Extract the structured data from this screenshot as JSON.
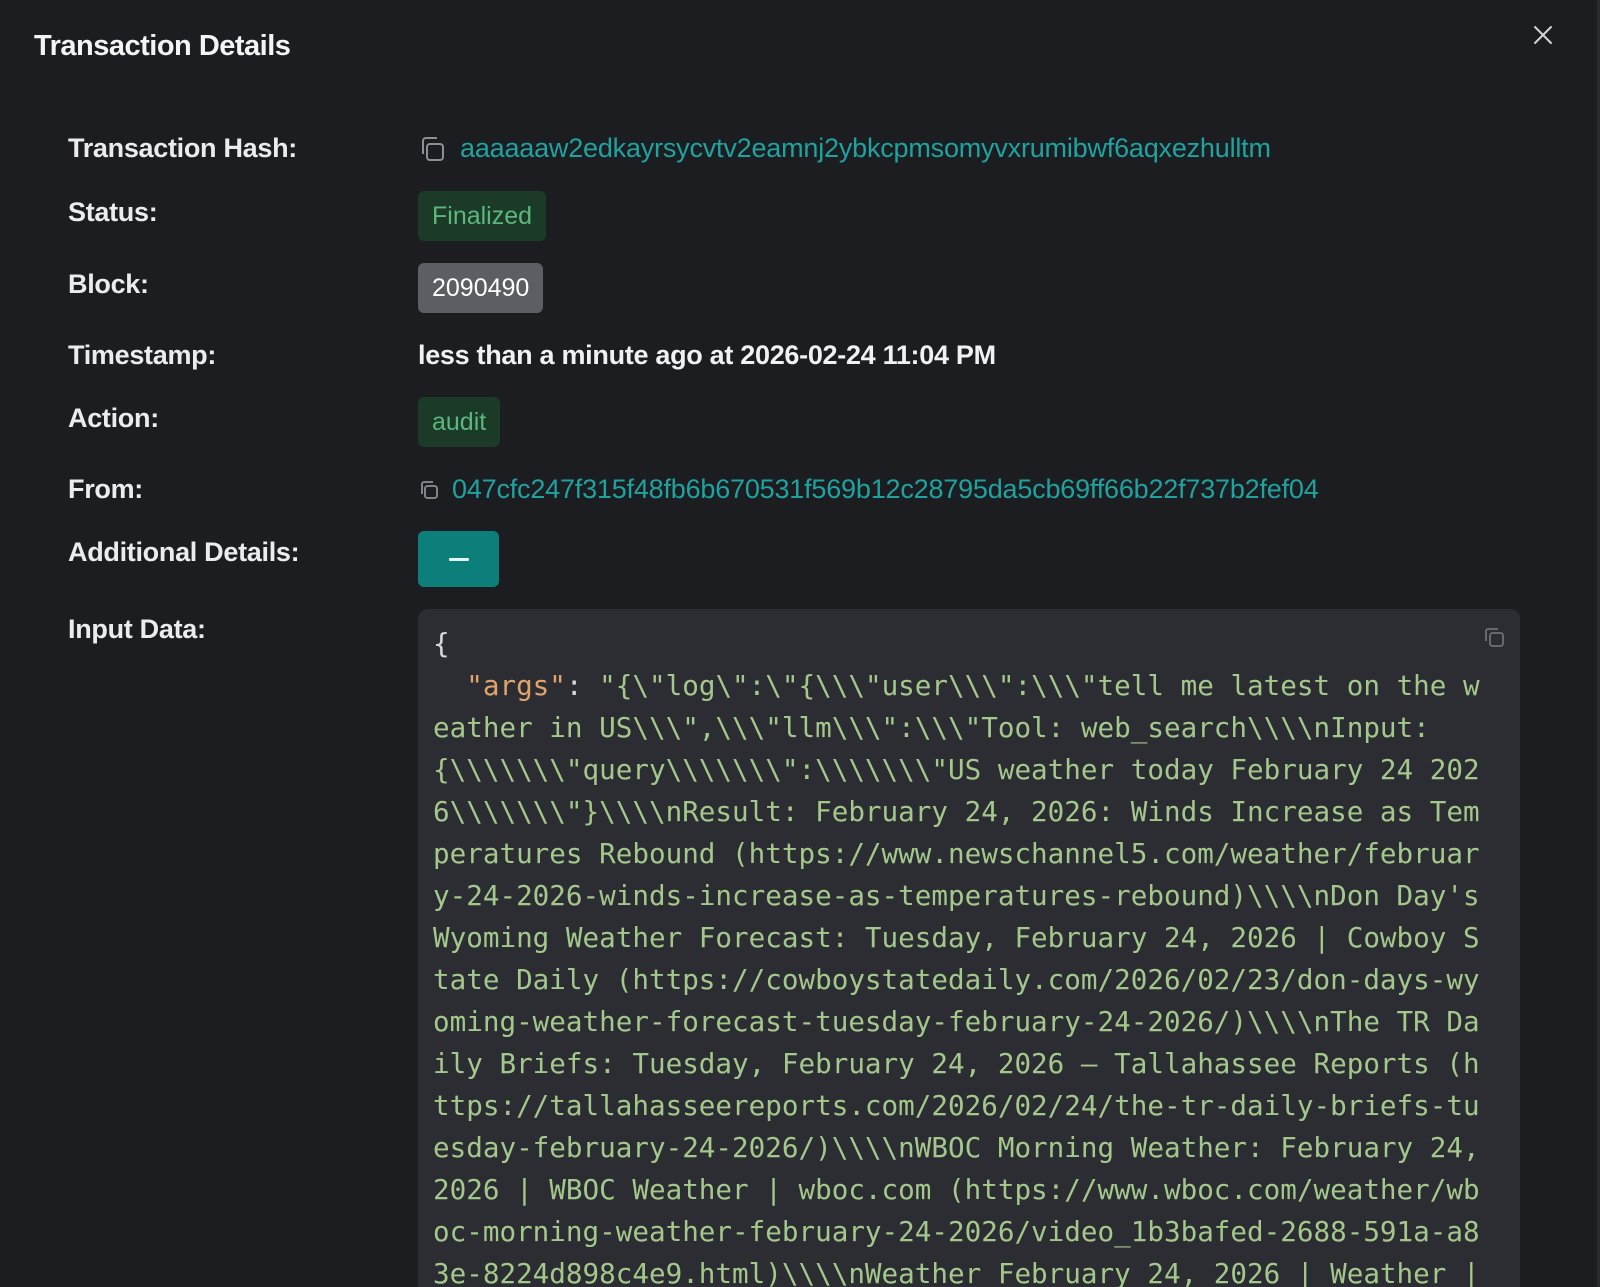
{
  "modal": {
    "title": "Transaction Details"
  },
  "fields": {
    "hash": {
      "label": "Transaction Hash:",
      "value": "aaaaaaw2edkayrsycvtv2eamnj2ybkcpmsomyvxrumibwf6aqxezhulltm"
    },
    "status": {
      "label": "Status:",
      "value": "Finalized"
    },
    "block": {
      "label": "Block:",
      "value": "2090490"
    },
    "timestamp": {
      "label": "Timestamp:",
      "value": "less than a minute ago at 2026-02-24 11:04 PM"
    },
    "action": {
      "label": "Action:",
      "value": "audit"
    },
    "from": {
      "label": "From:",
      "value": "047cfc247f315f48fb6b670531f569b12c28795da5cb69ff66b22f737b2fef04"
    },
    "additional": {
      "label": "Additional Details:",
      "toggle_symbol": "−"
    },
    "input": {
      "label": "Input Data:",
      "open_brace": "{",
      "key": "\"args\"",
      "colon": ": ",
      "value": "\"{\\\"log\\\":\\\"{\\\\\\\"user\\\\\\\":\\\\\\\"tell me latest on the weather in US\\\\\\\",\\\\\\\"llm\\\\\\\":\\\\\\\"Tool: web_search\\\\\\\\nInput: {\\\\\\\\\\\\\\\"query\\\\\\\\\\\\\\\":\\\\\\\\\\\\\\\"US weather today February 24 2026\\\\\\\\\\\\\\\"}\\\\\\\\nResult: February 24, 2026: Winds Increase as Temperatures Rebound (https://www.newschannel5.com/weather/february-24-2026-winds-increase-as-temperatures-rebound)\\\\\\\\nDon Day's Wyoming Weather Forecast: Tuesday, February 24, 2026 | Cowboy State Daily (https://cowboystatedaily.com/2026/02/23/don-days-wyoming-weather-forecast-tuesday-february-24-2026/)\\\\\\\\nThe TR Daily Briefs: Tuesday, February 24, 2026 – Tallahassee Reports (https://tallahasseereports.com/2026/02/24/the-tr-daily-briefs-tuesday-february-24-2026/)\\\\\\\\nWBOC Morning Weather: February 24, 2026 | WBOC Weather | wboc.com (https://www.wboc.com/weather/wboc-morning-weather-february-24-2026/video_1b3bafed-2688-591a-a83e-8224d898c4e9.html)\\\\\\\\nWeather February 24, 2026 | Weather |"
    }
  },
  "icons": {
    "close": "close-icon",
    "copy": "copy-icon"
  },
  "colors": {
    "background": "#1c1d20",
    "accent": "#1fa3a0",
    "toggle": "#0c7f7b",
    "badge_green_bg": "#1b3a28",
    "badge_green_text": "#5bb77e",
    "badge_gray_bg": "#5c5e64",
    "code_bg": "#2b2d33",
    "code_string": "#a4c78b",
    "code_key": "#e2a36b"
  }
}
